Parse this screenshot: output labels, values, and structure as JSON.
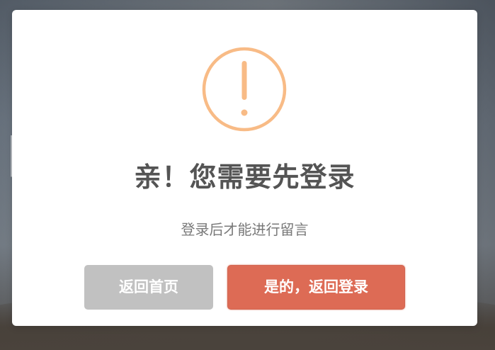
{
  "dialog": {
    "icon": "warning-icon",
    "icon_color": "#f8bb86",
    "title": "亲！您需要先登录",
    "message": "登录后才能进行留言",
    "cancel_label": "返回首页",
    "confirm_label": "是的，返回登录",
    "cancel_color": "#c1c1c1",
    "confirm_color": "#dd6b55"
  }
}
